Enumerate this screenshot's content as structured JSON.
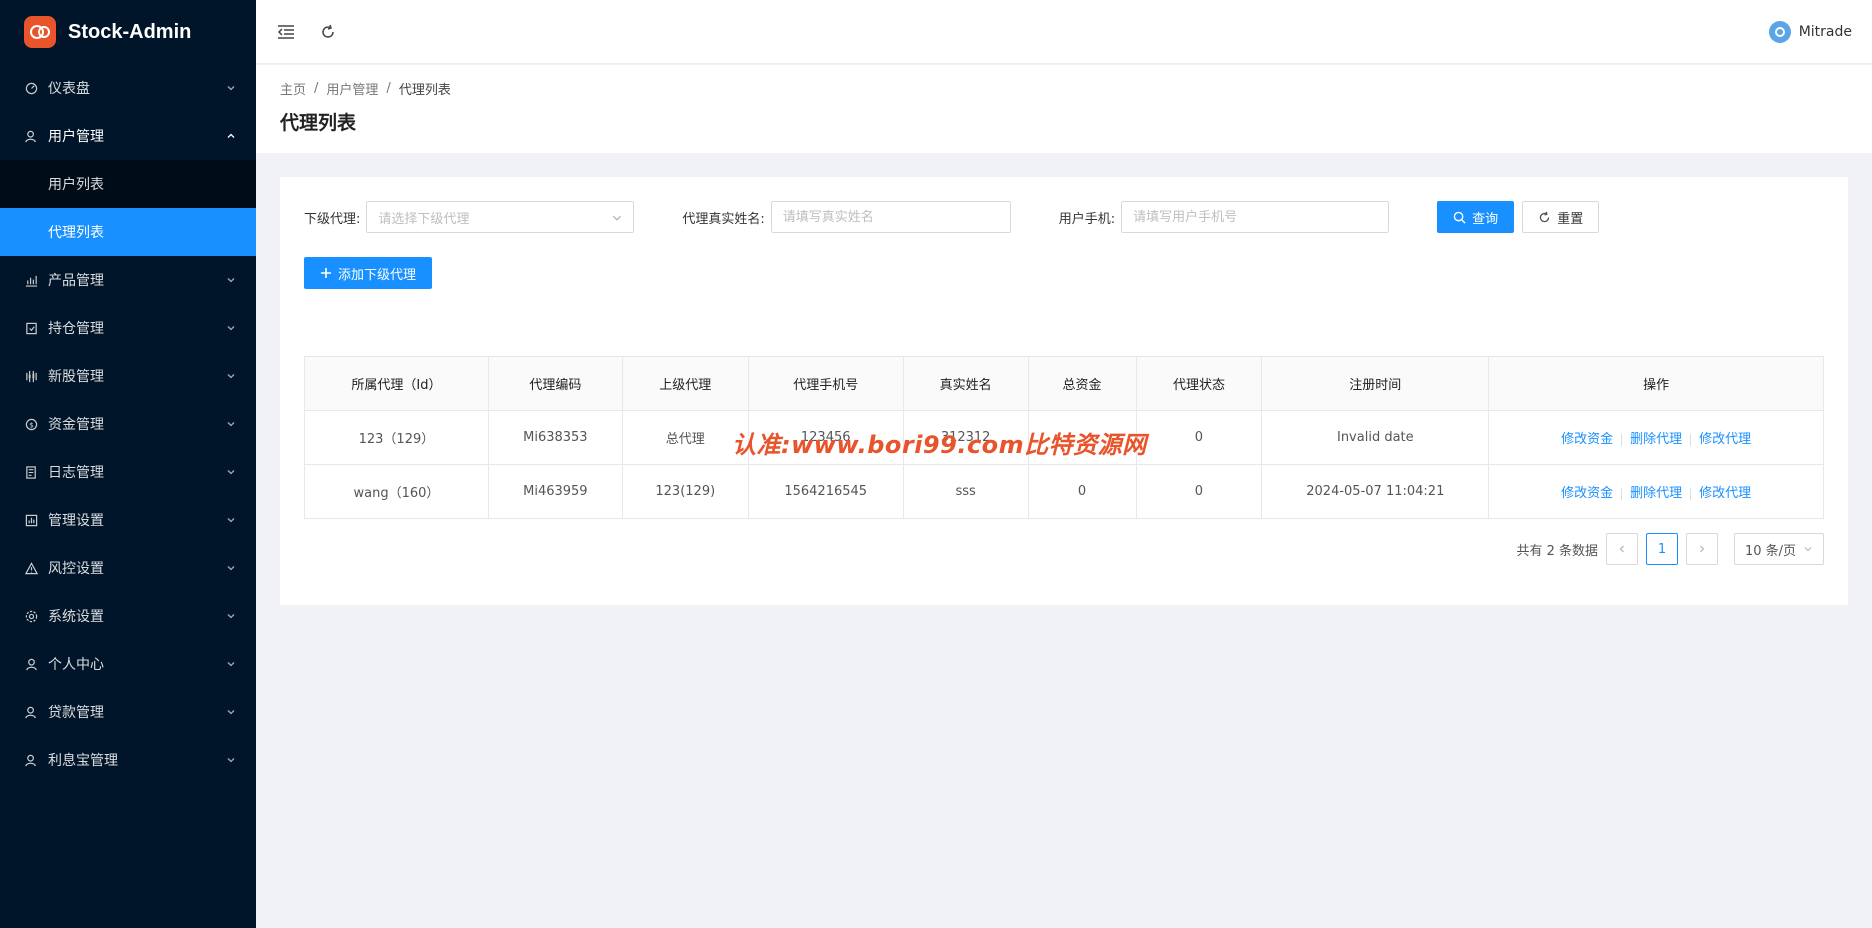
{
  "app": {
    "title": "Stock-Admin"
  },
  "sidebar": {
    "items": [
      {
        "label": "仪表盘",
        "icon": "dashboard-icon"
      },
      {
        "label": "用户管理",
        "icon": "user-manage-icon",
        "expanded": true,
        "children": [
          {
            "label": "用户列表"
          },
          {
            "label": "代理列表",
            "active": true
          }
        ]
      },
      {
        "label": "产品管理",
        "icon": "chart-icon"
      },
      {
        "label": "持仓管理",
        "icon": "position-icon"
      },
      {
        "label": "新股管理",
        "icon": "ipo-icon"
      },
      {
        "label": "资金管理",
        "icon": "money-icon"
      },
      {
        "label": "日志管理",
        "icon": "log-icon"
      },
      {
        "label": "管理设置",
        "icon": "admin-settings-icon"
      },
      {
        "label": "风控设置",
        "icon": "warning-icon"
      },
      {
        "label": "系统设置",
        "icon": "gear-icon"
      },
      {
        "label": "个人中心",
        "icon": "person-icon"
      },
      {
        "label": "贷款管理",
        "icon": "loan-icon"
      },
      {
        "label": "利息宝管理",
        "icon": "interest-icon"
      }
    ]
  },
  "header": {
    "user": "Mitrade"
  },
  "breadcrumb": [
    "主页",
    "用户管理",
    "代理列表"
  ],
  "page": {
    "title": "代理列表"
  },
  "filters": {
    "sub_agent_label": "下级代理:",
    "sub_agent_placeholder": "请选择下级代理",
    "real_name_label": "代理真实姓名:",
    "real_name_placeholder": "请填写真实姓名",
    "phone_label": "用户手机:",
    "phone_placeholder": "请填写用户手机号",
    "search_label": "查询",
    "reset_label": "重置"
  },
  "add_button": "添加下级代理",
  "table": {
    "columns": [
      "所属代理（Id）",
      "代理编码",
      "上级代理",
      "代理手机号",
      "真实姓名",
      "总资金",
      "代理状态",
      "注册时间",
      "操作"
    ],
    "rows": [
      [
        "123（129）",
        "Mi638353",
        "总代理",
        "123456",
        "312312",
        "",
        "0",
        "Invalid date"
      ],
      [
        "wang（160）",
        "Mi463959",
        "123(129)",
        "1564216545",
        "sss",
        "0",
        "0",
        "2024-05-07 11:04:21"
      ]
    ],
    "actions": [
      "修改资金",
      "删除代理",
      "修改代理"
    ]
  },
  "pagination": {
    "total_text": "共有 2 条数据",
    "current": "1",
    "page_size": "10 条/页"
  },
  "watermark": "认准:www.bori99.com比特资源网",
  "colors": {
    "sidebar_bg": "#001529",
    "primary": "#1890ff",
    "brand": "#e8542b"
  }
}
